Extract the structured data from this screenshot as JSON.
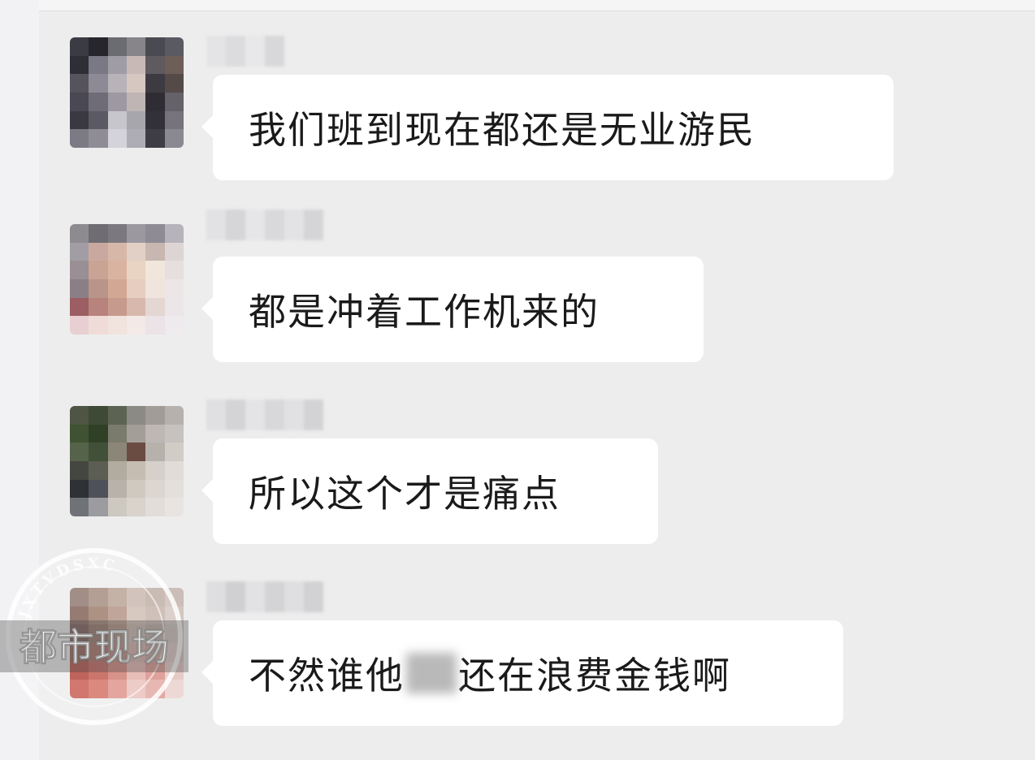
{
  "messages": [
    {
      "text": "我们班到现在都还是无业游民"
    },
    {
      "text": "都是冲着工作机来的"
    },
    {
      "text": "所以这个才是痛点"
    },
    {
      "text_before": "不然谁他",
      "text_after": "还在浪费金钱啊"
    }
  ],
  "watermark": {
    "title": "都市现场",
    "ring_text": "JXTVDSXC"
  },
  "colors": {
    "background": "#ededed",
    "bubble": "#ffffff",
    "text": "#1a1a1a"
  }
}
